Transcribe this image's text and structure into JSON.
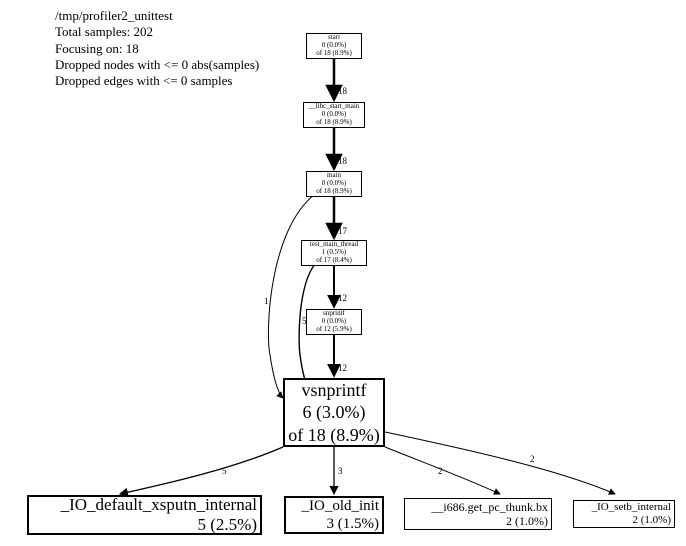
{
  "header": {
    "l1": "/tmp/profiler2_unittest",
    "l2": "Total samples: 202",
    "l3": "Focusing on: 18",
    "l4": "Dropped nodes with <= 0 abs(samples)",
    "l5": "Dropped edges with <= 0 samples"
  },
  "nodes": {
    "start": {
      "l1": "start",
      "l2": "0 (0.0%)",
      "l3": "of 18 (8.9%)"
    },
    "libc": {
      "l1": "__libc_start_main",
      "l2": "0 (0.0%)",
      "l3": "of 18 (8.9%)"
    },
    "main": {
      "l1": "main",
      "l2": "0 (0.0%)",
      "l3": "of 18 (8.9%)"
    },
    "testmain": {
      "l1": "test_main_thread",
      "l2": "1 (0.5%)",
      "l3": "of 17 (8.4%)"
    },
    "snprintf": {
      "l1": "snprintf",
      "l2": "0 (0.0%)",
      "l3": "of 12 (5.9%)"
    },
    "vsnprintf": {
      "l1": "vsnprintf",
      "l2": "6 (3.0%)",
      "l3": "of 18 (8.9%)"
    },
    "leaf1": {
      "l1": "_IO_default_xsputn_internal",
      "l2": "5 (2.5%)"
    },
    "leaf2": {
      "l1": "_IO_old_init",
      "l2": "3 (1.5%)"
    },
    "leaf3": {
      "l1": "__i686.get_pc_thunk.bx",
      "l2": "2 (1.0%)"
    },
    "leaf4": {
      "l1": "_IO_setb_internal",
      "l2": "2 (1.0%)"
    }
  },
  "edges": {
    "e_start_libc": "18",
    "e_libc_main": "18",
    "e_main_testmain": "17",
    "e_testmain_snprintf": "12",
    "e_snprintf_vsnprintf": "12",
    "e_testmain_vsnprintf": "5",
    "e_main_vsnprintf": "1",
    "e_vsn_leaf1": "5",
    "e_vsn_leaf2": "3",
    "e_vsn_leaf3": "2",
    "e_vsn_leaf4": "2"
  },
  "chart_data": {
    "type": "table",
    "title": "/tmp/profiler2_unittest call graph (focus=18 of 202 samples)",
    "nodes": [
      {
        "name": "start",
        "self_samples": 0,
        "self_pct": 0.0,
        "cum_samples": 18,
        "cum_pct": 8.9
      },
      {
        "name": "__libc_start_main",
        "self_samples": 0,
        "self_pct": 0.0,
        "cum_samples": 18,
        "cum_pct": 8.9
      },
      {
        "name": "main",
        "self_samples": 0,
        "self_pct": 0.0,
        "cum_samples": 18,
        "cum_pct": 8.9
      },
      {
        "name": "test_main_thread",
        "self_samples": 1,
        "self_pct": 0.5,
        "cum_samples": 17,
        "cum_pct": 8.4
      },
      {
        "name": "snprintf",
        "self_samples": 0,
        "self_pct": 0.0,
        "cum_samples": 12,
        "cum_pct": 5.9
      },
      {
        "name": "vsnprintf",
        "self_samples": 6,
        "self_pct": 3.0,
        "cum_samples": 18,
        "cum_pct": 8.9
      },
      {
        "name": "_IO_default_xsputn_internal",
        "self_samples": 5,
        "self_pct": 2.5
      },
      {
        "name": "_IO_old_init",
        "self_samples": 3,
        "self_pct": 1.5
      },
      {
        "name": "__i686.get_pc_thunk.bx",
        "self_samples": 2,
        "self_pct": 1.0
      },
      {
        "name": "_IO_setb_internal",
        "self_samples": 2,
        "self_pct": 1.0
      }
    ],
    "edges": [
      {
        "from": "start",
        "to": "__libc_start_main",
        "samples": 18
      },
      {
        "from": "__libc_start_main",
        "to": "main",
        "samples": 18
      },
      {
        "from": "main",
        "to": "test_main_thread",
        "samples": 17
      },
      {
        "from": "main",
        "to": "vsnprintf",
        "samples": 1
      },
      {
        "from": "test_main_thread",
        "to": "snprintf",
        "samples": 12
      },
      {
        "from": "test_main_thread",
        "to": "vsnprintf",
        "samples": 5
      },
      {
        "from": "snprintf",
        "to": "vsnprintf",
        "samples": 12
      },
      {
        "from": "vsnprintf",
        "to": "_IO_default_xsputn_internal",
        "samples": 5
      },
      {
        "from": "vsnprintf",
        "to": "_IO_old_init",
        "samples": 3
      },
      {
        "from": "vsnprintf",
        "to": "__i686.get_pc_thunk.bx",
        "samples": 2
      },
      {
        "from": "vsnprintf",
        "to": "_IO_setb_internal",
        "samples": 2
      }
    ],
    "totals": {
      "total_samples": 202,
      "focus_samples": 18
    }
  }
}
